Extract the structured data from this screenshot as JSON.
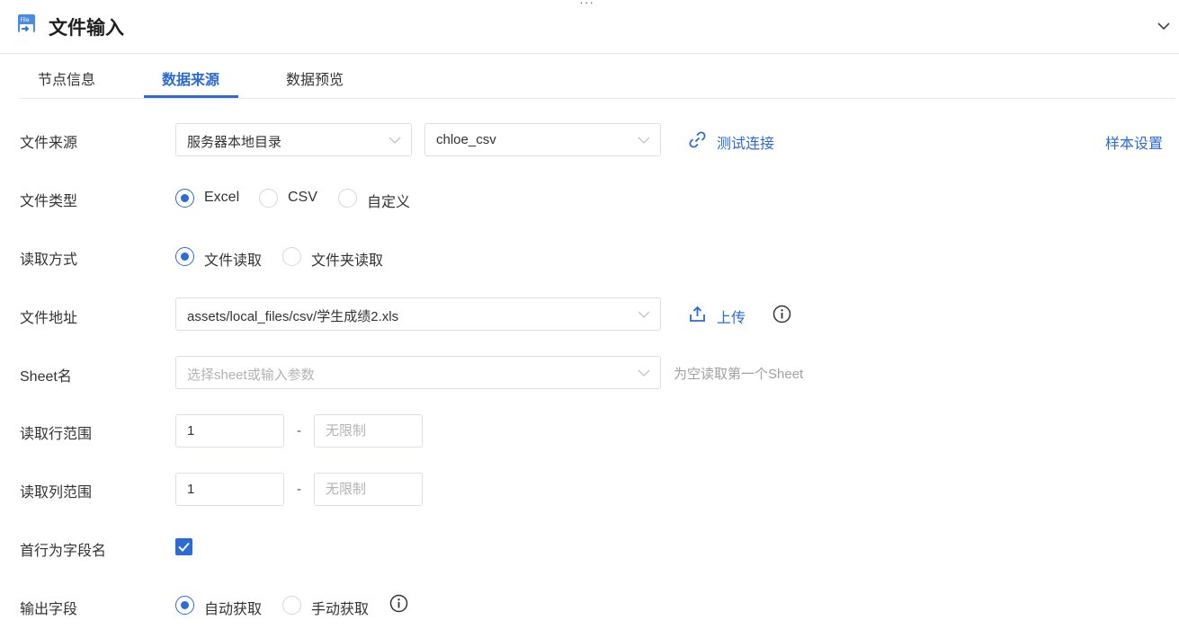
{
  "header": {
    "title": "文件输入",
    "drag_handle": "···",
    "file_icon_text": "File"
  },
  "tabs": [
    {
      "label": "节点信息",
      "active": false
    },
    {
      "label": "数据来源",
      "active": true
    },
    {
      "label": "数据预览",
      "active": false
    }
  ],
  "form": {
    "file_source": {
      "label": "文件来源",
      "source_type": "服务器本地目录",
      "connection": "chloe_csv",
      "test_link": "测试连接",
      "sample_settings": "样本设置"
    },
    "file_type": {
      "label": "文件类型",
      "options": [
        "Excel",
        "CSV",
        "自定义"
      ],
      "selected": "Excel"
    },
    "read_mode": {
      "label": "读取方式",
      "options": [
        "文件读取",
        "文件夹读取"
      ],
      "selected": "文件读取"
    },
    "file_path": {
      "label": "文件地址",
      "value": "assets/local_files/csv/学生成绩2.xls",
      "upload_label": "上传"
    },
    "sheet_name": {
      "label": "Sheet名",
      "placeholder": "选择sheet或输入参数",
      "hint": "为空读取第一个Sheet"
    },
    "row_range": {
      "label": "读取行范围",
      "from": "1",
      "separator": "-",
      "to_placeholder": "无限制"
    },
    "col_range": {
      "label": "读取列范围",
      "from": "1",
      "separator": "-",
      "to_placeholder": "无限制"
    },
    "first_row_header": {
      "label": "首行为字段名",
      "checked": true
    },
    "output_fields": {
      "label": "输出字段",
      "options": [
        "自动获取",
        "手动获取"
      ],
      "selected": "自动获取"
    }
  },
  "colors": {
    "accent": "#2a6ad9",
    "border": "#dcdfe6",
    "placeholder": "#b3b3b3"
  }
}
